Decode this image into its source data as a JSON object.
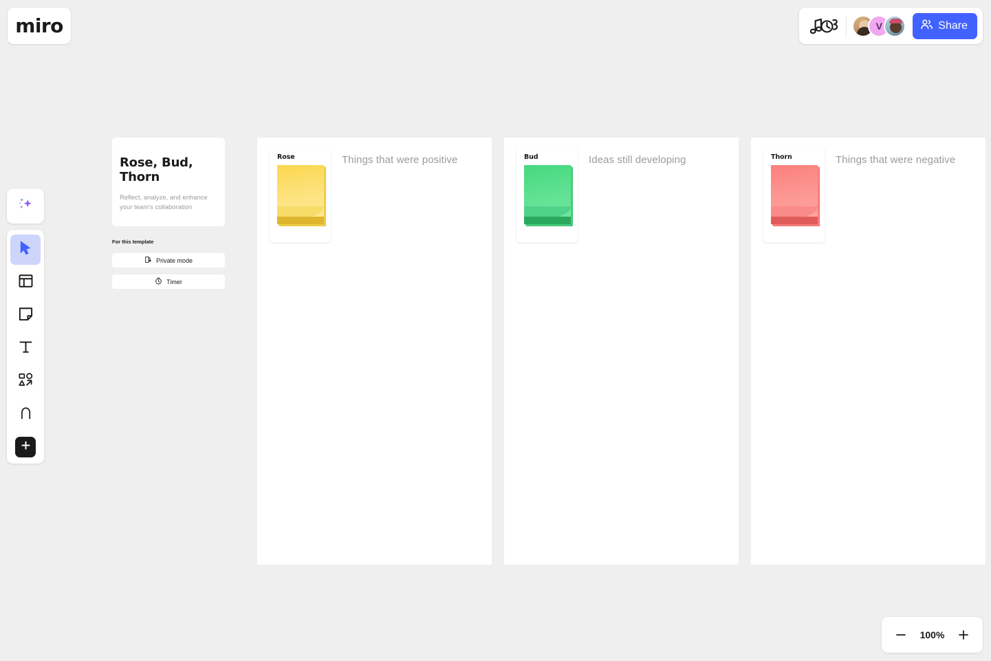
{
  "app": {
    "logo_text": "miro"
  },
  "topbar": {
    "music_icon": "music-notes-icon",
    "avatars": [
      {
        "name": "collaborator-1",
        "initial": ""
      },
      {
        "name": "collaborator-2",
        "initial": "V"
      },
      {
        "name": "collaborator-3",
        "initial": ""
      }
    ],
    "share_label": "Share",
    "share_color": "#4262ff"
  },
  "toolbar": {
    "items": [
      {
        "name": "ai-sparkle-tool",
        "icon": "sparkles-icon",
        "active": false
      },
      {
        "name": "select-tool",
        "icon": "cursor-icon",
        "active": true
      },
      {
        "name": "template-tool",
        "icon": "template-icon",
        "active": false
      },
      {
        "name": "sticky-note-tool",
        "icon": "sticky-note-icon",
        "active": false
      },
      {
        "name": "text-tool",
        "icon": "text-t-icon",
        "active": false
      },
      {
        "name": "shapes-tool",
        "icon": "shapes-icon",
        "active": false
      },
      {
        "name": "pen-tool",
        "icon": "pen-icon",
        "active": false
      },
      {
        "name": "more-apps-tool",
        "icon": "plus-icon",
        "active": false
      }
    ]
  },
  "info_panel": {
    "title": "Rose, Bud, Thorn",
    "subtitle": "Reflect, analyze, and enhance your team's collaboration",
    "section_label": "For this template",
    "buttons": [
      {
        "label": "Private mode",
        "icon": "curtain-icon"
      },
      {
        "label": "Timer",
        "icon": "stopwatch-icon"
      }
    ]
  },
  "board": {
    "frames": [
      {
        "label": "Rose",
        "description": "Things that were positive",
        "color": "#fbdc5f",
        "shade": "#d9b62c",
        "curve": "#e8c63f"
      },
      {
        "label": "Bud",
        "description": "Ideas still developing",
        "color": "#5bdc88",
        "shade": "#2fab5c",
        "curve": "#45c472"
      },
      {
        "label": "Thorn",
        "description": "Things that were negative",
        "color": "#fb8a86",
        "shade": "#e0595a",
        "curve": "#f07370"
      }
    ]
  },
  "zoom_control": {
    "minus_label": "minus-icon",
    "value": "100%",
    "plus_label": "plus-icon"
  }
}
